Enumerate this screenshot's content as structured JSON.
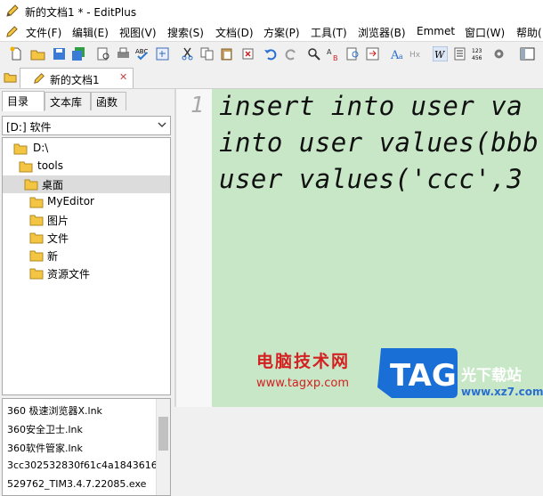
{
  "window": {
    "title": "新的文档1 * - EditPlus"
  },
  "menu": [
    {
      "label": "文件(F)"
    },
    {
      "label": "编辑(E)"
    },
    {
      "label": "视图(V)"
    },
    {
      "label": "搜索(S)"
    },
    {
      "label": "文档(D)"
    },
    {
      "label": "方案(P)"
    },
    {
      "label": "工具(T)"
    },
    {
      "label": "浏览器(B)"
    },
    {
      "label": "Emmet"
    },
    {
      "label": "窗口(W)"
    },
    {
      "label": "帮助("
    }
  ],
  "toolbar": {
    "icons": [
      "new-file-icon",
      "open-folder-icon",
      "save-icon",
      "save-all-icon",
      "print-preview-icon",
      "print-icon",
      "spell-check-icon",
      "browser-preview-icon",
      "cut-icon",
      "copy-icon",
      "paste-icon",
      "delete-icon",
      "undo-icon",
      "redo-icon",
      "find-icon",
      "replace-icon",
      "find-in-files-icon",
      "goto-icon",
      "font-icon",
      "hex-icon",
      "word-wrap-icon",
      "column-select-icon",
      "ruler-icon",
      "settings-icon",
      "fullscreen-icon"
    ]
  },
  "tabs": {
    "document": "新的文档1"
  },
  "panel": {
    "tabs": [
      "目录",
      "文本库",
      "函数"
    ],
    "drive": "[D:] 软件",
    "tree": [
      {
        "label": "D:\\",
        "depth": 1,
        "selected": false
      },
      {
        "label": "tools",
        "depth": 2,
        "selected": false
      },
      {
        "label": "桌面",
        "depth": 3,
        "selected": true
      },
      {
        "label": "MyEditor",
        "depth": 4,
        "selected": false
      },
      {
        "label": "图片",
        "depth": 4,
        "selected": false
      },
      {
        "label": "文件",
        "depth": 4,
        "selected": false
      },
      {
        "label": "新",
        "depth": 4,
        "selected": false
      },
      {
        "label": "资源文件",
        "depth": 4,
        "selected": false
      }
    ],
    "files": [
      "360 极速浏览器X.lnk",
      "360安全卫士.lnk",
      "360软件管家.lnk",
      "3cc302532830f61c4a1843616",
      "529762_TIM3.4.7.22085.exe"
    ]
  },
  "editor": {
    "line_number": "1",
    "lines": [
      "insert into user va",
      "into user values(bbb",
      "user values('ccc',3"
    ]
  },
  "watermark": {
    "site_name": "电脑技术网",
    "url": "www.tagxp.com",
    "logo_text": "TAG",
    "side_text": "光下载站",
    "side_url": "www.xz7.com"
  },
  "colors": {
    "editor_bg": "#c7e7c7",
    "logo_blue": "#1a6fd6",
    "watermark_red": "#d42020"
  }
}
